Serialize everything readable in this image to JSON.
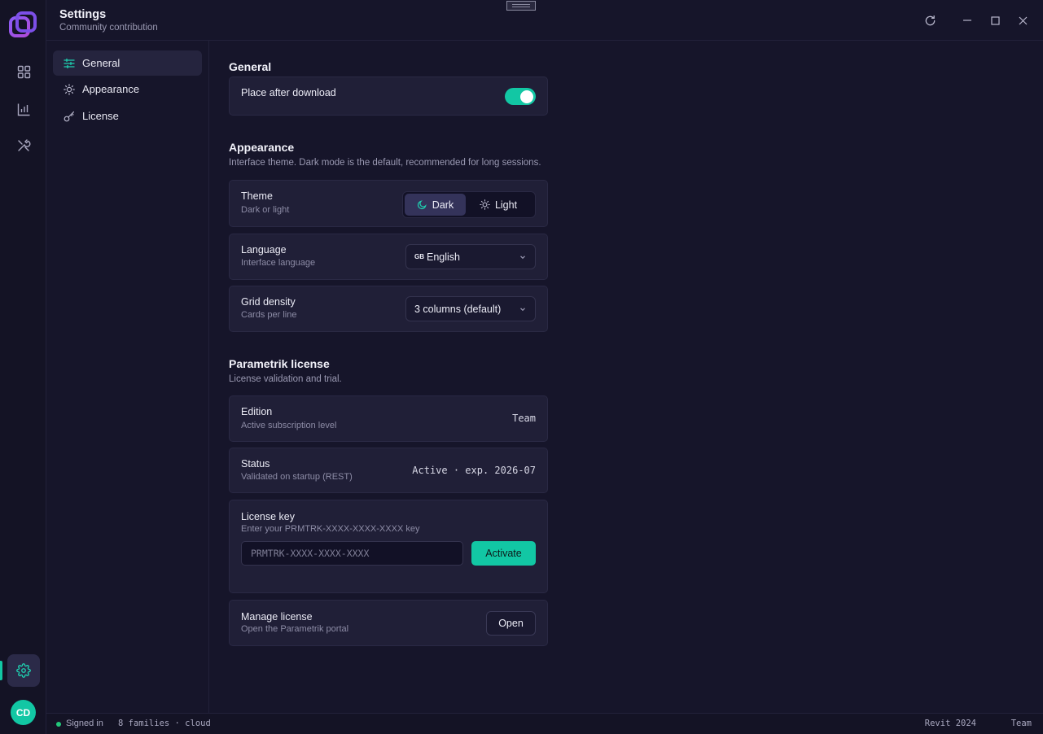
{
  "window": {
    "title": "Settings",
    "subtitle": "Community contribution"
  },
  "rail": {
    "items": [
      {
        "icon": "grid-icon"
      },
      {
        "icon": "chart-icon"
      },
      {
        "icon": "tools-icon"
      }
    ],
    "settings_icon": "gear-icon",
    "avatar_initials": "CD"
  },
  "sidebar": {
    "items": [
      {
        "label": "General",
        "icon": "sliders-icon",
        "active": true
      },
      {
        "label": "Appearance",
        "icon": "sun-icon",
        "active": false
      },
      {
        "label": "License",
        "icon": "key-icon",
        "active": false
      }
    ]
  },
  "general": {
    "title": "General",
    "place_after_download": {
      "label": "Place after download",
      "enabled": true
    }
  },
  "appearance": {
    "title": "Appearance",
    "description": "Interface theme. Dark mode is the default, recommended for long sessions.",
    "theme": {
      "label": "Theme",
      "sub": "Dark or light",
      "options": [
        "Dark",
        "Light"
      ],
      "selected": "Dark"
    },
    "language": {
      "label": "Language",
      "sub": "Interface language",
      "flag": "GB",
      "value": "English"
    },
    "grid_density": {
      "label": "Grid density",
      "sub": "Cards per line",
      "value": "3 columns (default)"
    }
  },
  "license": {
    "title": "Parametrik license",
    "description": "License validation and trial.",
    "edition": {
      "label": "Edition",
      "sub": "Active subscription level",
      "value": "Team"
    },
    "status": {
      "label": "Status",
      "sub": "Validated on startup (REST)",
      "value": "Active · exp. 2026-07"
    },
    "key": {
      "label": "License key",
      "sub": "Enter your PRMTRK-XXXX-XXXX-XXXX key",
      "placeholder": "PRMTRK-XXXX-XXXX-XXXX",
      "button": "Activate"
    },
    "manage": {
      "label": "Manage license",
      "sub": "Open the Parametrik portal",
      "button": "Open"
    }
  },
  "statusbar": {
    "signed_in": "Signed in",
    "families": "8 families · cloud",
    "revit": "Revit 2024",
    "plan": "Team"
  },
  "colors": {
    "accent": "#12c7a4",
    "background": "#16152a",
    "card": "#201f37"
  }
}
